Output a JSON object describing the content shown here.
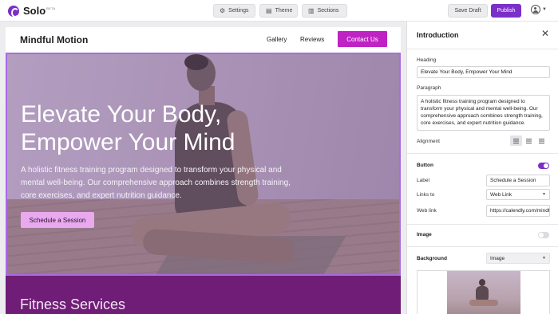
{
  "app": {
    "name": "Solo",
    "badge": "BETA"
  },
  "toolbar": {
    "settings_label": "Settings",
    "theme_label": "Theme",
    "sections_label": "Sections",
    "save_draft_label": "Save Draft",
    "publish_label": "Publish"
  },
  "site": {
    "brand": "Mindful Motion",
    "nav": {
      "gallery": "Gallery",
      "reviews": "Reviews",
      "contact": "Contact Us"
    },
    "hero": {
      "title": "Elevate Your Body, Empower Your Mind",
      "paragraph": "A holistic fitness training program designed to transform your physical and mental well-being. Our comprehensive approach combines strength training, core exercises, and expert nutrition guidance.",
      "button_label": "Schedule a Session"
    },
    "services_title": "Fitness Services"
  },
  "panel": {
    "title": "Introduction",
    "heading_label": "Heading",
    "heading_value": "Elevate Your Body, Empower Your Mind",
    "paragraph_label": "Paragraph",
    "paragraph_value": "A holistic fitness training program designed to transform your physical and mental well-being. Our comprehensive approach combines strength training, core exercises, and expert nutrition guidance.",
    "alignment_label": "Alignment",
    "alignment_selected": "left",
    "button_section": {
      "title": "Button",
      "enabled": true,
      "label_label": "Label",
      "label_value": "Schedule a Session",
      "links_to_label": "Links to",
      "links_to_value": "Web Link",
      "web_link_label": "Web link",
      "web_link_value": "https://calendly.com/mindfulmotion"
    },
    "image_section": {
      "title": "Image",
      "enabled": false
    },
    "background_section": {
      "title": "Background",
      "type_value": "Image"
    }
  },
  "colors": {
    "accent": "#7b2fc9",
    "nav_cta": "#bf23c3",
    "hero_cta": "#e9a9ee",
    "services_bg": "#6f1d76",
    "selection_outline": "#a96be3"
  },
  "icons": {
    "settings": "sliders-icon",
    "theme": "palette-icon",
    "sections": "layout-icon",
    "close": "close-icon",
    "user": "user-circle-icon"
  }
}
